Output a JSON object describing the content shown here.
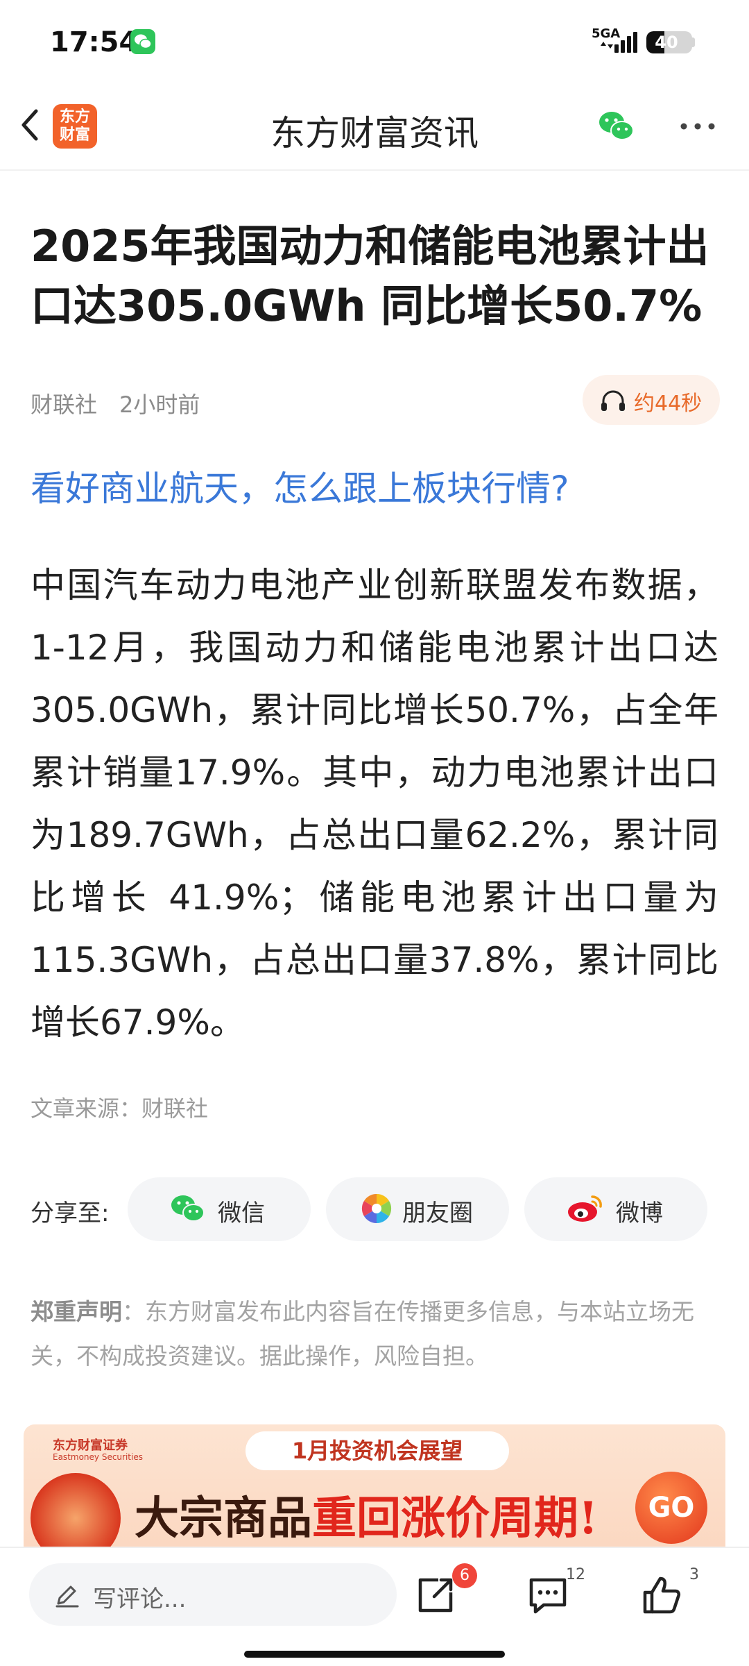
{
  "status_bar": {
    "time": "17:54",
    "network": "5GA",
    "battery": "40",
    "battery_level": 0.4,
    "notification_icon": "wechat-icon"
  },
  "nav": {
    "back_icon": "chevron-left-icon",
    "logo_text": "东方财富",
    "title": "东方财富资讯",
    "share_icon": "wechat-icon",
    "more_icon": "more-dots-icon"
  },
  "article": {
    "title": "2025年我国动力和储能电池累计出口达305.0GWh 同比增长50.7%",
    "source": "财联社",
    "time": "2小时前",
    "listen": {
      "icon": "headphones-icon",
      "label": "约44秒"
    },
    "promo_link": "看好商业航天，怎么跟上板块行情?",
    "body": "中国汽车动力电池产业创新联盟发布数据，1-12月，我国动力和储能电池累计出口达305.0GWh，累计同比增长50.7%，占全年累计销量17.9%。其中，动力电池累计出口为189.7GWh，占总出口量62.2%，累计同比增长 41.9%；储能电池累计出口量为115.3GWh，占总出口量37.8%，累计同比增长67.9%。",
    "source_line": "文章来源：财联社"
  },
  "share": {
    "label": "分享至:",
    "wechat": "微信",
    "moments": "朋友圈",
    "weibo": "微博"
  },
  "disclaimer": {
    "lead": "郑重声明",
    "text": "：东方财富发布此内容旨在传播更多信息，与本站立场无关，不构成投资建议。据此操作，风险自担。"
  },
  "banner": {
    "brand": "东方财富证券",
    "brand_en": "Eastmoney Securities",
    "tag": "1月投资机会展望",
    "headline_a": "大宗商品",
    "headline_b": "重回涨价周期!",
    "go": "GO"
  },
  "bottom_bar": {
    "comment_placeholder": "写评论...",
    "share_count": "6",
    "comment_count": "12",
    "like_count": "3"
  },
  "colors": {
    "accent_orange": "#f2622a",
    "link_blue": "#3a78d8",
    "badge_red": "#f0453a"
  }
}
